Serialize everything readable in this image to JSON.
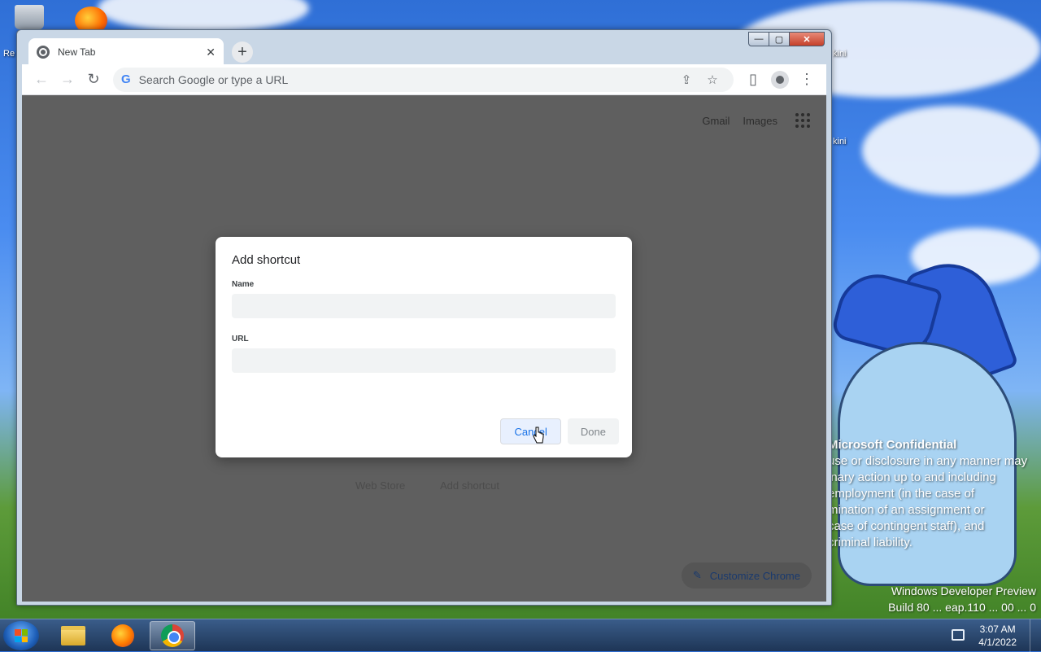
{
  "desktop": {
    "watermark": {
      "title": "Microsoft Confidential",
      "lines": [
        "use or disclosure in any manner may",
        "inary action up to and including",
        "employment (in the case of",
        "mination of an assignment or",
        "case of contingent staff), and",
        "criminal liability."
      ]
    },
    "build_lines": [
      "Windows Developer Preview",
      "Build 80 ... eap.110 ... 00 ... 0"
    ],
    "icon_labels": [
      "Re",
      "kini",
      "kini"
    ]
  },
  "window": {
    "controls": {
      "minimize": "—",
      "maximize": "▢",
      "close": "✕"
    }
  },
  "tab": {
    "title": "New Tab",
    "close": "✕"
  },
  "newtab": {
    "label": "+"
  },
  "toolbar": {
    "back": "←",
    "forward": "→",
    "reload": "↻",
    "omnibox_placeholder": "Search Google or type a URL",
    "g_logo": "G",
    "share": "⇪",
    "bookmark": "☆",
    "sidepanel": "▯",
    "menu": "⋮"
  },
  "page": {
    "links": {
      "gmail": "Gmail",
      "images": "Images"
    },
    "ghost": {
      "webstore": "Web Store",
      "add_shortcut": "Add shortcut"
    },
    "customize": {
      "icon": "✎",
      "label": "Customize Chrome"
    }
  },
  "dialog": {
    "title": "Add shortcut",
    "name_label": "Name",
    "name_value": "",
    "url_label": "URL",
    "url_value": "",
    "cancel": "Cancel",
    "done": "Done"
  },
  "taskbar": {
    "clock_time": "3:07 AM",
    "clock_date": "4/1/2022"
  }
}
